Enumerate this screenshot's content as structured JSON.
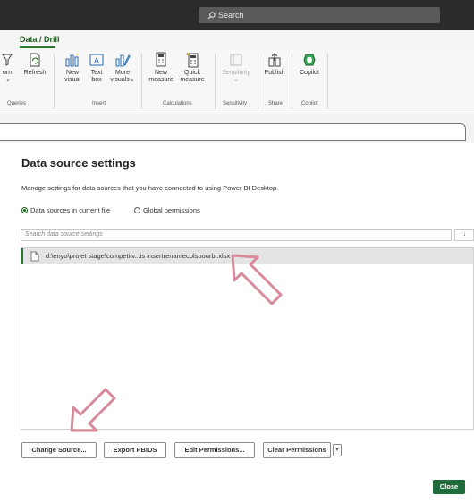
{
  "titlebar": {
    "search_label": "Search"
  },
  "ribbon": {
    "active_tab": "Data / Drill",
    "buttons": {
      "transform_line1": "orm",
      "transform_line2": "⌄",
      "refresh": "Refresh",
      "new_visual_1": "New",
      "new_visual_2": "visual",
      "text_box_1": "Text",
      "text_box_2": "box",
      "more_visuals_1": "More",
      "more_visuals_2": "visuals⌄",
      "new_measure_1": "New",
      "new_measure_2": "measure",
      "quick_measure_1": "Quick",
      "quick_measure_2": "measure",
      "sensitivity_1": "Sensitivity",
      "sensitivity_2": "⌄",
      "publish": "Publish",
      "copilot": "Copilot"
    },
    "groups": {
      "queries": "Queries",
      "insert": "Insert",
      "calculations": "Calculations",
      "sensitivity": "Sensitivity",
      "share": "Share",
      "copilot": "Copilot"
    }
  },
  "dialog": {
    "title": "Data source settings",
    "description": "Manage settings for data sources that you have connected to using Power BI Desktop.",
    "radio_current": "Data sources in current file",
    "radio_global": "Global permissions",
    "search_placeholder": "Search data source settings",
    "sort_label": "↑↓",
    "sources": [
      {
        "path": "d:\\enyo\\projet stage\\competitv...is insertrenamecolspourbi.xlsx"
      }
    ],
    "buttons": {
      "change_source": "Change Source...",
      "export_pbids": "Export PBIDS",
      "edit_permissions": "Edit Permissions...",
      "clear_permissions": "Clear Permissions",
      "close": "Close"
    }
  },
  "colors": {
    "accent": "#1f6b39",
    "arrow": "#d98a9a",
    "titlebar": "#2b2b2b"
  }
}
